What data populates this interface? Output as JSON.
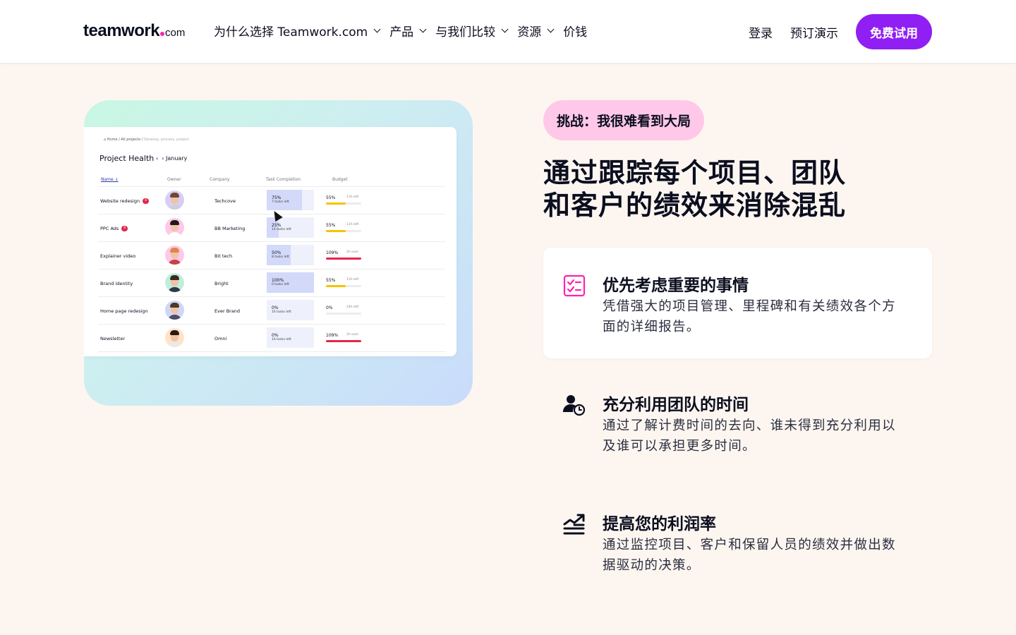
{
  "nav": {
    "logo": {
      "main": "teamwork",
      "suffix": "com"
    },
    "menu": [
      {
        "label": "为什么选择 Teamwork.com",
        "dropdown": true
      },
      {
        "label": "产品",
        "dropdown": true
      },
      {
        "label": "与我们比较",
        "dropdown": true
      },
      {
        "label": "资源",
        "dropdown": true
      },
      {
        "label": "价钱",
        "dropdown": false
      }
    ],
    "login": "登录",
    "demo": "预订演示",
    "cta": "免费试用"
  },
  "screenshot": {
    "breadcrumbs": [
      "Home",
      "All projects",
      "Develop, process, project"
    ],
    "title": "Project Health",
    "period": "January",
    "columns": [
      "Name",
      "Owner",
      "Company",
      "Task Completion",
      "Budget"
    ],
    "rows": [
      {
        "name": "Website redesign",
        "badge": "4",
        "company": "Techcove",
        "task_pct": "75%",
        "task_fraction": 0.75,
        "tasks_left": "7 tasks left",
        "budget_pct": "55%",
        "budget_fraction": 0.55,
        "budget_note": "11h left",
        "budget_color": "#f5c400"
      },
      {
        "name": "PPC Ads",
        "badge": "8",
        "company": "BB Marketing",
        "task_pct": "25%",
        "task_fraction": 0.25,
        "tasks_left": "14 tasks left",
        "budget_pct": "55%",
        "budget_fraction": 0.55,
        "budget_note": "11h left",
        "budget_color": "#f5c400"
      },
      {
        "name": "Explainer video",
        "badge": "",
        "company": "Bit tech",
        "task_pct": "50%",
        "task_fraction": 0.5,
        "tasks_left": "8 tasks left",
        "budget_pct": "109%",
        "budget_fraction": 1.0,
        "budget_note": "2h over",
        "budget_color": "#e5264a"
      },
      {
        "name": "Brand identity",
        "badge": "",
        "company": "Bright",
        "task_pct": "100%",
        "task_fraction": 1.0,
        "tasks_left": "0 tasks left",
        "budget_pct": "55%",
        "budget_fraction": 0.55,
        "budget_note": "11h left",
        "budget_color": "#f5c400"
      },
      {
        "name": "Home page redesign",
        "badge": "",
        "company": "Ever Brand",
        "task_pct": "0%",
        "task_fraction": 0,
        "tasks_left": "16 tasks left",
        "budget_pct": "0%",
        "budget_fraction": 0,
        "budget_note": "24h left",
        "budget_color": "#f5c400"
      },
      {
        "name": "Newsletter",
        "badge": "",
        "company": "Omni",
        "task_pct": "0%",
        "task_fraction": 0,
        "tasks_left": "16 tasks left",
        "budget_pct": "109%",
        "budget_fraction": 1.0,
        "budget_note": "2h over",
        "budget_color": "#e5264a"
      }
    ]
  },
  "challenge": "挑战：我很难看到大局",
  "headline": [
    "通过跟踪每个项目、团队",
    "和客户的绩效来消除混乱"
  ],
  "features": [
    {
      "icon": "checklist-icon",
      "title": "优先考虑重要的事情",
      "desc": "凭借强大的项目管理、里程碑和有关绩效各个方面的详细报告。",
      "active": true
    },
    {
      "icon": "user-clock-icon",
      "title": "充分利用团队的时间",
      "desc": "通过了解计费时间的去向、谁未得到充分利用以及谁可以承担更多时间。",
      "active": false
    },
    {
      "icon": "growth-chart-icon",
      "title": "提高您的利润率",
      "desc": "通过监控项目、客户和保留人员的绩效并做出数据驱动的决策。",
      "active": false
    }
  ],
  "colors": {
    "brand": "#8f1ff2",
    "accent_pink": "#ff22b1",
    "pill_bg": "#ffc8e8",
    "page_bg": "#fdf6f0"
  }
}
